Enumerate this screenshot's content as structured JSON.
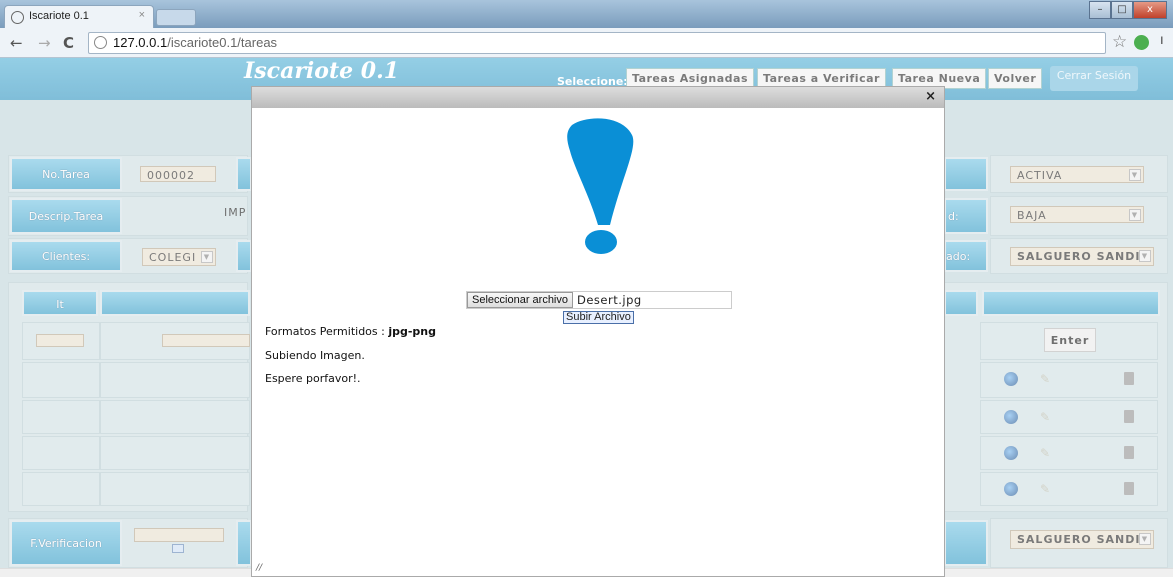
{
  "browser": {
    "tab_title": "Iscariote 0.1",
    "tab_close": "×",
    "url_host": "127.0.0.1",
    "url_path": "/iscariote0.1/tareas",
    "window_controls": [
      "–",
      "□",
      "x"
    ]
  },
  "header": {
    "logo": "Iscariote 0.1",
    "select_label": "Seleccione:",
    "nav": [
      "Tareas Asignadas",
      "Tareas a Verificar",
      "Tarea Nueva",
      "Volver"
    ],
    "logout": "Cerrar Sesión"
  },
  "form": {
    "no_tarea_label": "No.Tarea",
    "no_tarea_value": "000002",
    "descrip_label": "Descrip.Tarea",
    "descrip_value": "IMP",
    "clientes_label": "Clientes:",
    "clientes_value": "COLEGI",
    "status_value": "ACTIVA",
    "priority_suffix": "d:",
    "priority_value": "BAJA",
    "assigned_suffix": "ado:",
    "assigned_value": "SALGUERO SANDI",
    "it_label": "It",
    "enter_button": "Enter",
    "fverif_label": "F.Verificacion",
    "verifier_value": "SALGUERO SANDI"
  },
  "modal": {
    "close": "×",
    "file_button": "Seleccionar archivo",
    "file_name": "Desert.jpg",
    "upload_button": "Subir Archivo",
    "formats_label": "Formatos Permitidos : ",
    "formats_value": "jpg-png",
    "status_1": "Subiendo Imagen.",
    "status_2": "Espere porfavor!.",
    "resize_handle": "//"
  }
}
